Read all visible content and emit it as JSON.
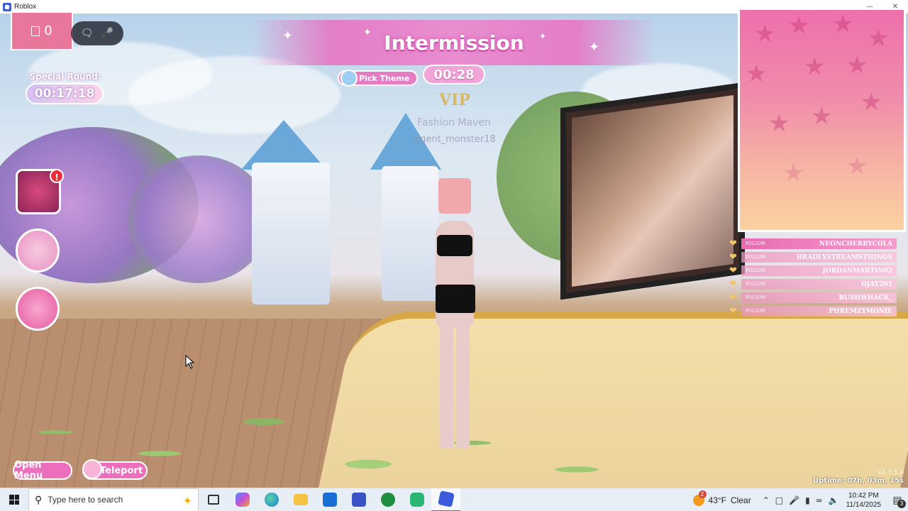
{
  "window": {
    "title": "Roblox"
  },
  "hud": {
    "coins": "0",
    "special_round_label": "Special Round:",
    "special_round_timer": "00:17:18",
    "banner_title": "Intermission",
    "pick_theme_label": "Pick Theme",
    "timer": "00:28",
    "vip_label": "VIP",
    "player_title": "Fashion Maven",
    "player_name": "Agent_monster18",
    "baddie_badge": "!",
    "open_menu_label": "Open Menu",
    "teleport_label": "Teleport",
    "version": "v2.3.5.4",
    "uptime": "Uptime: 07h, 03m, 15s"
  },
  "stream_overlay": {
    "follow_tag": "FOLLOW",
    "followers": [
      "NEONCHERRYCOLA",
      "BRADLYSTREAMSTHINGS",
      "JORDANMARTIN02",
      "OJAY201",
      "BUSHWHACK_",
      "PHREMZYMONIE"
    ],
    "colors": {
      "panel_top": "#ee6fab",
      "panel_bottom": "#fbd2a0",
      "star": "#c83c78"
    }
  },
  "taskbar": {
    "search_placeholder": "Type here to search",
    "weather_temp": "43°F",
    "weather_text": "Clear",
    "weather_badge": "2",
    "time": "10:42 PM",
    "date": "11/14/2025",
    "notifications": "3",
    "apps": [
      "task-view-icon",
      "copilot-app-icon",
      "edge-icon",
      "file-explorer-icon",
      "outlook-icon",
      "app-icon",
      "xbox-icon",
      "discord-icon",
      "roblox-icon"
    ]
  },
  "colors": {
    "accent_pink": "#ec6fbd",
    "banner_pink": "#e37ec7",
    "vip_gold": "#d8b45a"
  }
}
